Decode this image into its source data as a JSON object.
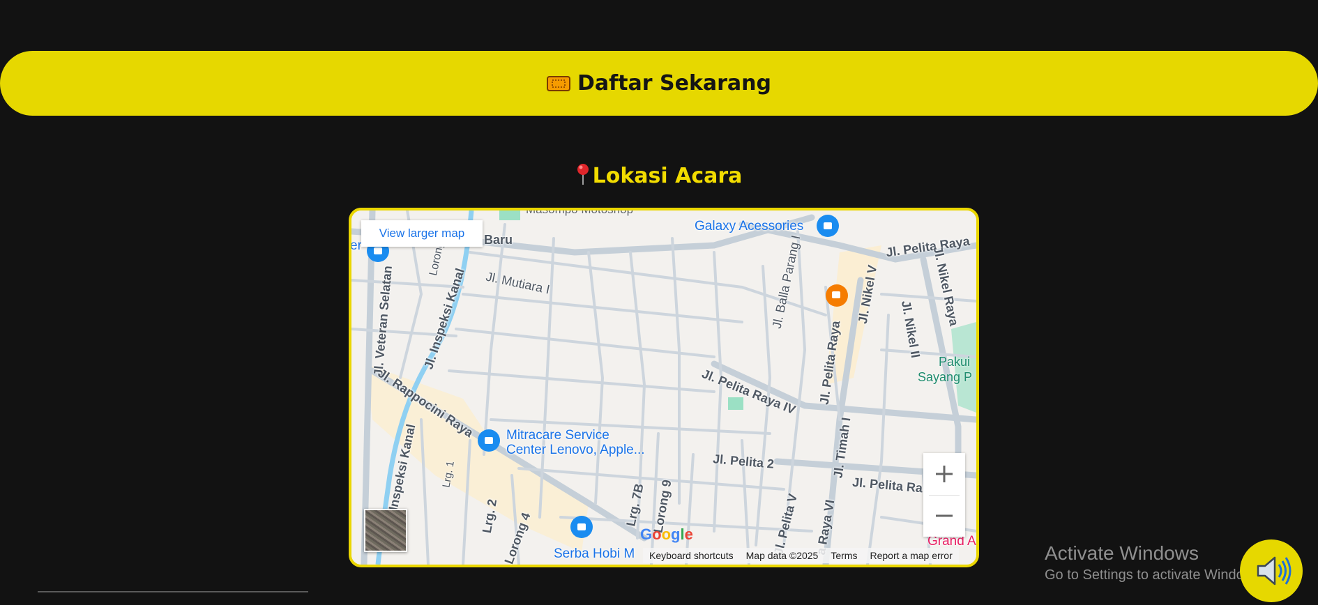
{
  "cta": {
    "icon": "ticket-icon",
    "label": "Daftar Sekarang",
    "color": "#e6d800"
  },
  "location": {
    "icon": "round-pushpin-icon",
    "title": "Lokasi Acara",
    "color": "#f2dc00"
  },
  "map": {
    "view_larger": "View larger map",
    "google_logo": "Google",
    "attribution": {
      "keyboard": "Keyboard shortcuts",
      "map_data": "Map data ©2025",
      "terms": "Terms",
      "report": "Report a map error"
    },
    "zoom_in": "+",
    "zoom_out": "−",
    "streets": {
      "veteran_selatan": "Jl. Veteran Selatan",
      "inspeksi_kanal": "Jl. Inspeksi Kanal",
      "inspeksi_kanal_2": "Inspeksi Kanal",
      "rappocini": "Jl. Rappocini Raya",
      "mutiara": "Jl. Mutiara I",
      "baru": "Baru",
      "lorong": "Lorong",
      "balla_parang": "Jl. Balla Parang I",
      "pelita_raya_iv": "Jl. Pelita Raya IV",
      "pelita_raya_v": "Jl. Pelita Raya",
      "pelita_raya_top": "Jl. Pelita Raya",
      "nikel_v": "Jl. Nikel V",
      "nikel_ii": "Jl. Nikel II",
      "nikel_raya": "Jl. Nikel Raya",
      "timah_i": "Jl. Timah I",
      "pelita_2": "Jl. Pelita 2",
      "pelita_ra": "Jl. Pelita Ra",
      "lrg_1": "Lrg. 1",
      "lrg_2": "Lrg. 2",
      "lorong_4": "Lorong 4",
      "lrg_7b": "Lrg. 7B",
      "lorong_9": "Lorong 9",
      "pelita_v": "Jl. Pelita V",
      "raya_vi": "a Raya VI"
    },
    "pois": {
      "galaxy": "Galaxy Acessories",
      "mitracare_1": "Mitracare Service",
      "mitracare_2": "Center Lenovo, Apple...",
      "serba": "Serba Hobi M",
      "grand": "Grand A",
      "park_1": "Pakui",
      "park_2": "Sayang P",
      "top_cut": "Masompo Motoshop",
      "left_cut": "er"
    }
  },
  "watermark": {
    "line1": "Activate Windows",
    "line2": "Go to Settings to activate Windows."
  },
  "audio": {
    "icon": "speaker-icon"
  }
}
